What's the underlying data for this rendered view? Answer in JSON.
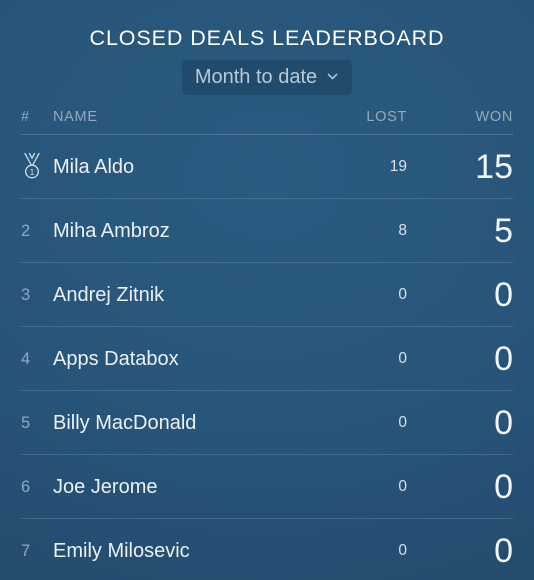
{
  "widget": {
    "title": "CLOSED DEALS LEADERBOARD",
    "background_color": "#27557a",
    "accent_color": "#e9f0f6"
  },
  "period_selector": {
    "label": "Month to date",
    "icon": "chevron-down-icon"
  },
  "table": {
    "headers": {
      "rank": "#",
      "name": "NAME",
      "lost": "LOST",
      "won": "WON"
    },
    "rows": [
      {
        "rank": "",
        "rank_icon": "medal-icon",
        "medal_number": "1",
        "name": "Mila Aldo",
        "lost": "19",
        "won": "15"
      },
      {
        "rank": "2",
        "rank_icon": "",
        "medal_number": "",
        "name": "Miha Ambroz",
        "lost": "8",
        "won": "5"
      },
      {
        "rank": "3",
        "rank_icon": "",
        "medal_number": "",
        "name": "Andrej Zitnik",
        "lost": "0",
        "won": "0"
      },
      {
        "rank": "4",
        "rank_icon": "",
        "medal_number": "",
        "name": "Apps Databox",
        "lost": "0",
        "won": "0"
      },
      {
        "rank": "5",
        "rank_icon": "",
        "medal_number": "",
        "name": "Billy MacDonald",
        "lost": "0",
        "won": "0"
      },
      {
        "rank": "6",
        "rank_icon": "",
        "medal_number": "",
        "name": "Joe Jerome",
        "lost": "0",
        "won": "0"
      },
      {
        "rank": "7",
        "rank_icon": "",
        "medal_number": "",
        "name": "Emily Milosevic",
        "lost": "0",
        "won": "0"
      }
    ]
  }
}
